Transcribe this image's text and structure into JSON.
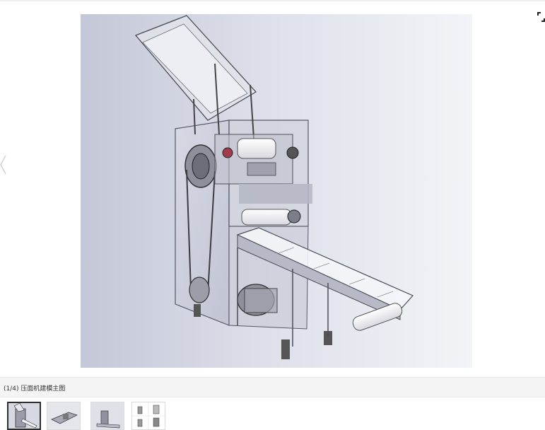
{
  "viewer": {
    "caption": "(1/4) 压面机建模主图",
    "thumbnails": [
      {
        "name": "thumbnail-1",
        "active": true
      },
      {
        "name": "thumbnail-2",
        "active": false
      },
      {
        "name": "thumbnail-3",
        "active": false
      },
      {
        "name": "thumbnail-4",
        "active": false
      }
    ],
    "icons": {
      "prev": "chevron-left-icon",
      "fullscreen": "fullscreen-icon"
    }
  },
  "colors": {
    "stage_left": "#c4c7d7",
    "stage_right": "#f3f4f8",
    "caption_bar": "#f4f4f4",
    "active_thumb_border": "#2d2d2d"
  }
}
